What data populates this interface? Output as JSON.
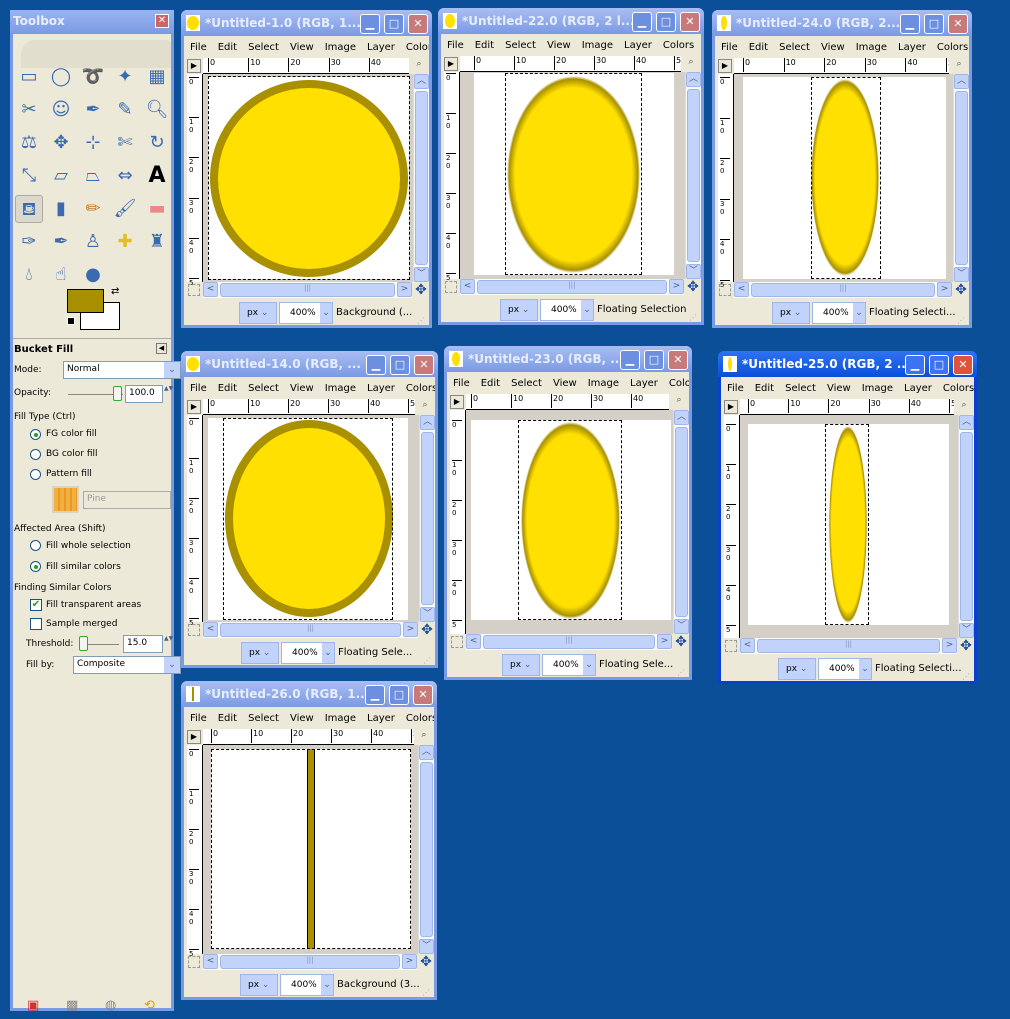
{
  "colors": {
    "fg": "#a89000",
    "bg": "#ffffff",
    "fill": "#ffe000",
    "outline": "#a89000",
    "desktop": "#0a4f97"
  },
  "toolbox": {
    "title": "Toolbox",
    "tools": [
      "rect-select-icon",
      "ellipse-select-icon",
      "lasso-icon",
      "magic-wand-icon",
      "select-by-color-icon",
      "scissors-icon",
      "foreground-select-icon",
      "paths-icon",
      "color-picker-icon",
      "magnify-icon",
      "measure-icon",
      "move-icon",
      "align-icon",
      "crop-icon",
      "rotate-icon",
      "scale-icon",
      "shear-icon",
      "perspective-icon",
      "flip-icon",
      "text-icon",
      "bucket-fill-icon",
      "blend-icon",
      "pencil-icon",
      "paintbrush-icon",
      "eraser-icon",
      "airbrush-icon",
      "ink-icon",
      "clone-icon",
      "heal-icon",
      "perspective-clone-icon",
      "blur-icon",
      "smudge-icon",
      "dodge-burn-icon"
    ],
    "active_tool": "bucket-fill-icon",
    "options": {
      "title": "Bucket Fill",
      "mode_label": "Mode:",
      "mode_value": "Normal",
      "opacity_label": "Opacity:",
      "opacity_value": "100.0",
      "fill_type_label": "Fill Type  (Ctrl)",
      "fill_types": [
        {
          "label": "FG color fill",
          "selected": true
        },
        {
          "label": "BG color fill",
          "selected": false
        },
        {
          "label": "Pattern fill",
          "selected": false
        }
      ],
      "pattern_name": "Pine",
      "affected_label": "Affected Area  (Shift)",
      "affected": [
        {
          "label": "Fill whole selection",
          "selected": false
        },
        {
          "label": "Fill similar colors",
          "selected": true
        }
      ],
      "finding_label": "Finding Similar Colors",
      "fill_transparent": {
        "label": "Fill transparent areas",
        "checked": true
      },
      "sample_merged": {
        "label": "Sample merged",
        "checked": false
      },
      "threshold_label": "Threshold:",
      "threshold_value": "15.0",
      "fill_by_label": "Fill by:",
      "fill_by_value": "Composite"
    },
    "bottom_icons": [
      "save-icon",
      "restore-icon",
      "delete-icon",
      "reset-icon"
    ]
  },
  "menu": [
    "File",
    "Edit",
    "Select",
    "View",
    "Image",
    "Layer",
    "Colors"
  ],
  "ruler_ticks": [
    "0",
    "10",
    "20",
    "30",
    "40",
    "50"
  ],
  "vruler_ticks": [
    "0",
    "1 0",
    "2 0",
    "3 0",
    "4 0",
    "5"
  ],
  "windows": [
    {
      "title": "*Untitled-1.0 (RGB, 1...",
      "unit": "px",
      "zoom": "400%",
      "status": "Background (...",
      "active": false
    },
    {
      "title": "*Untitled-22.0 (RGB, 2 l...",
      "unit": "px",
      "zoom": "400%",
      "status": "Floating Selection",
      "active": false
    },
    {
      "title": "*Untitled-24.0 (RGB, 2...",
      "unit": "px",
      "zoom": "400%",
      "status": "Floating Selecti...",
      "active": false
    },
    {
      "title": "*Untitled-14.0 (RGB, ...",
      "unit": "px",
      "zoom": "400%",
      "status": "Floating Sele...",
      "active": false
    },
    {
      "title": "*Untitled-23.0 (RGB, ...",
      "unit": "px",
      "zoom": "400%",
      "status": "Floating Sele...",
      "active": false
    },
    {
      "title": "*Untitled-25.0 (RGB, 2 ...",
      "unit": "px",
      "zoom": "400%",
      "status": "Floating Selecti...",
      "active": true
    },
    {
      "title": "*Untitled-26.0 (RGB, 1...",
      "unit": "px",
      "zoom": "400%",
      "status": "Background (3...",
      "active": false
    }
  ]
}
